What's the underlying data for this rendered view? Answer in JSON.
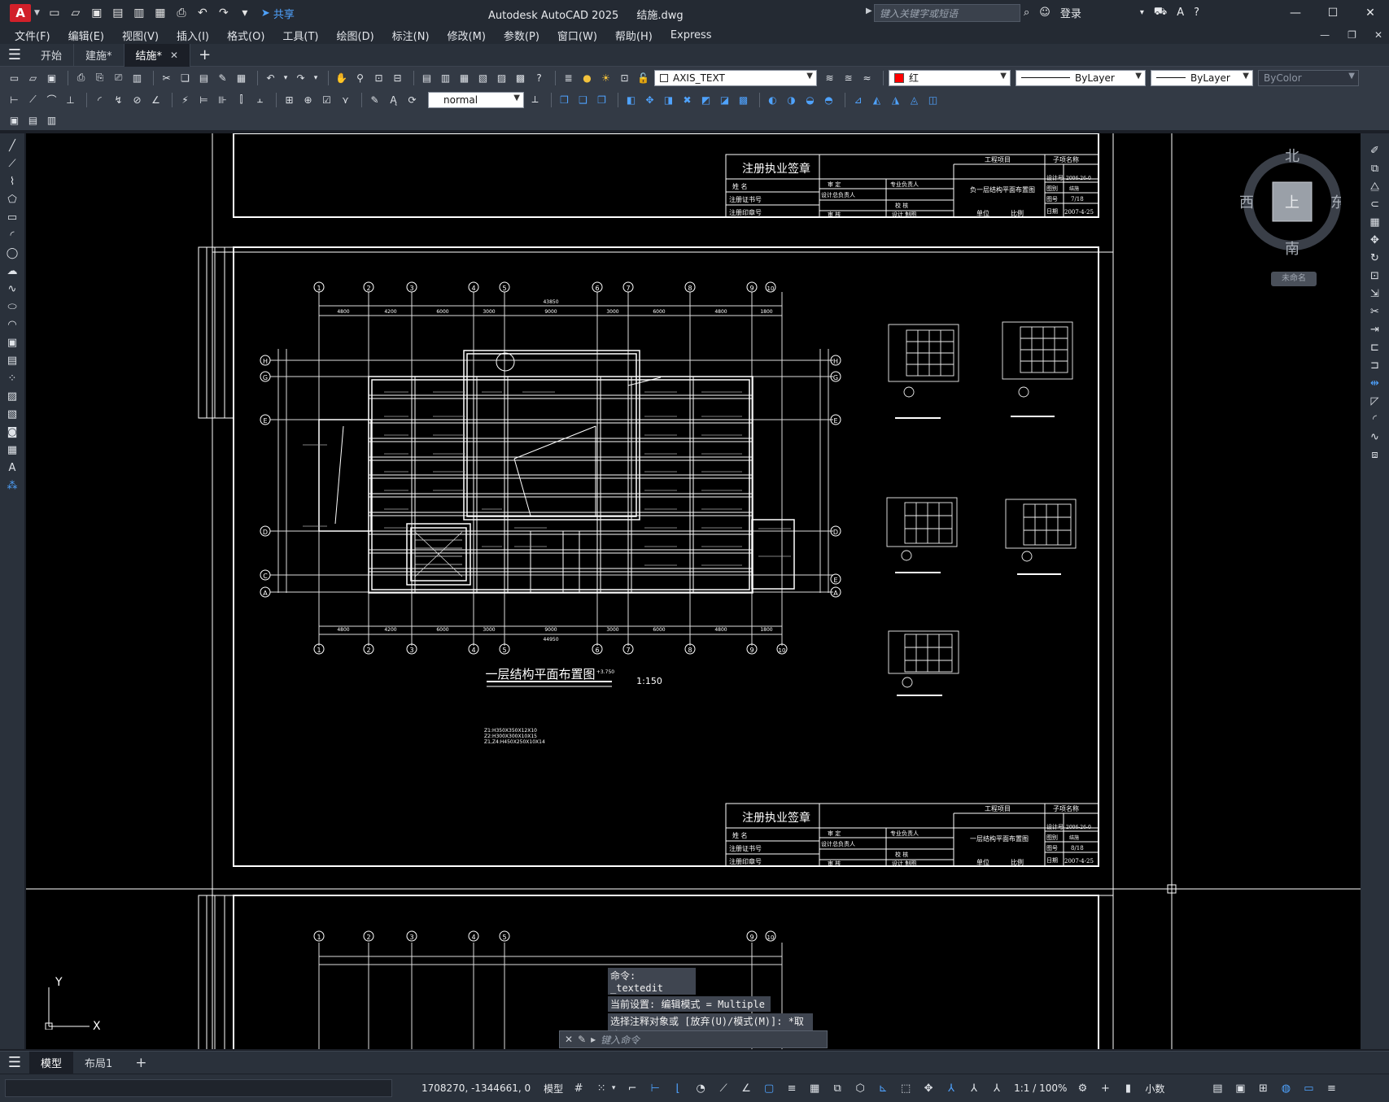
{
  "app": {
    "logo_letter": "A",
    "share_label": "共享",
    "product": "Autodesk AutoCAD 2025",
    "filename": "结施.dwg",
    "search_placeholder": "键入关键字或短语",
    "login_label": "登录"
  },
  "menu": [
    "文件(F)",
    "编辑(E)",
    "视图(V)",
    "插入(I)",
    "格式(O)",
    "工具(T)",
    "绘图(D)",
    "标注(N)",
    "修改(M)",
    "参数(P)",
    "窗口(W)",
    "帮助(H)",
    "Express"
  ],
  "tabs": {
    "start": "开始",
    "tab1": "建施*",
    "tab2": "结施*"
  },
  "toolbar": {
    "layer_name": "AXIS_TEXT",
    "color_name": "红",
    "color_hex": "#ff0000",
    "linetype": "ByLayer",
    "lineweight": "ByLayer",
    "plotstyle": "ByColor",
    "dimstyle": "normal"
  },
  "drawing": {
    "stamp_title": "注册执业签章",
    "stamp_row1": "姓  名",
    "stamp_row2": "注册证书号",
    "stamp_row3": "注册印章号",
    "col_shending": "审  定",
    "col_zhuanye": "专业负责人",
    "col_sheji": "设计总负责人",
    "col_jiaohe": "校  核",
    "col_shenhe": "审  核",
    "col_shejizhitu": "设计  制图",
    "project_label": "工程项目",
    "subitem_label": "子项名称",
    "unit_label": "单位",
    "ratio_label": "比例",
    "top_sheet_title": "负一层结构平面布置图",
    "main_sheet_title": "一层结构平面布置图",
    "design_no_label": "设计号",
    "design_no": "2006-26-0",
    "drawing_type_label": "图别",
    "drawing_type": "结施",
    "drawing_no_label": "图号",
    "top_drawing_no": "7/18",
    "main_drawing_no": "8/18",
    "date_label": "日期",
    "date": "2007-4-25",
    "plan_caption": "一层结构平面布置图",
    "plan_scale": "1:150",
    "elev_mark": "+3.750",
    "axis_labels_x": [
      "1",
      "2",
      "3",
      "4",
      "5",
      "6",
      "7",
      "8",
      "9",
      "10"
    ],
    "axis_labels_y": [
      "H",
      "G",
      "F",
      "E",
      "D",
      "C",
      "B",
      "A"
    ],
    "dim_top_total": "43850",
    "dim_bottom_total": "44950",
    "dim_segments": [
      "4800",
      "4200",
      "6000",
      "3000",
      "9000",
      "3000",
      "6000",
      "4800",
      "1800"
    ],
    "notes": [
      "Z1:H350X350X12X10",
      "Z2:H300X300X10X15",
      "Z1,Z4:H450X250X10X14"
    ]
  },
  "viewcube": {
    "north": "北",
    "south": "南",
    "east": "东",
    "west": "西",
    "top_face": "上",
    "wcs": "未命名"
  },
  "command": {
    "line1": "命令: _textedit",
    "line2": "当前设置: 编辑模式 = Multiple",
    "line3": "选择注释对象或 [放弃(U)/模式(M)]: *取消*",
    "placeholder": "键入命令"
  },
  "ucs": {
    "x": "X",
    "y": "Y"
  },
  "layouts": {
    "model": "模型",
    "layout1": "布局1"
  },
  "status": {
    "coords": "1708270, -1344661, 0",
    "space": "模型",
    "scale": "1:1 / 100%",
    "units": "小数"
  }
}
